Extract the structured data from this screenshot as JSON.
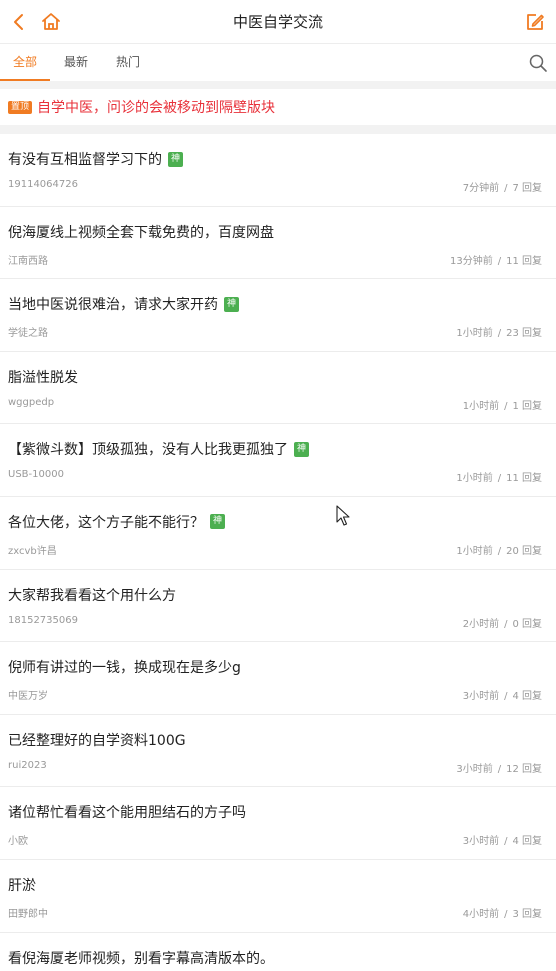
{
  "header": {
    "title": "中医自学交流",
    "back_icon": "chevron-left-icon",
    "home_icon": "home-icon",
    "edit_icon": "edit-icon",
    "accent_color": "#f07b22"
  },
  "tabs": [
    {
      "label": "全部",
      "active": true
    },
    {
      "label": "最新",
      "active": false
    },
    {
      "label": "热门",
      "active": false
    }
  ],
  "pinned": {
    "badge": "置顶",
    "title": "自学中医，问诊的会被移动到隔壁版块",
    "color": "#e8313a"
  },
  "posts": [
    {
      "title": "有没有互相监督学习下的",
      "badge": "神",
      "author": "19114064726",
      "time": "7分钟前",
      "replies": "7 回复"
    },
    {
      "title": "倪海厦线上视频全套下载免费的，百度网盘",
      "badge": "",
      "author": "江南西路",
      "time": "13分钟前",
      "replies": "11 回复"
    },
    {
      "title": "当地中医说很难治，请求大家开药",
      "badge": "神",
      "author": "学徒之路",
      "time": "1小时前",
      "replies": "23 回复"
    },
    {
      "title": "脂溢性脱发",
      "badge": "",
      "author": "wggpedp",
      "time": "1小时前",
      "replies": "1 回复"
    },
    {
      "title": "【紫微斗数】顶级孤独，没有人比我更孤独了",
      "badge": "神",
      "author": "USB-10000",
      "time": "1小时前",
      "replies": "11 回复"
    },
    {
      "title": "各位大佬，这个方子能不能行？",
      "badge": "神",
      "author": "zxcvb许昌",
      "time": "1小时前",
      "replies": "20 回复"
    },
    {
      "title": "大家帮我看看这个用什么方",
      "badge": "",
      "author": "18152735069",
      "time": "2小时前",
      "replies": "0 回复"
    },
    {
      "title": "倪师有讲过的一钱，换成现在是多少g",
      "badge": "",
      "author": "中医万岁",
      "time": "3小时前",
      "replies": "4 回复"
    },
    {
      "title": "已经整理好的自学资料100G",
      "badge": "",
      "author": "rui2023",
      "time": "3小时前",
      "replies": "12 回复"
    },
    {
      "title": "诸位帮忙看看这个能用胆结石的方子吗",
      "badge": "",
      "author": "小欧",
      "time": "3小时前",
      "replies": "4 回复"
    },
    {
      "title": "肝淤",
      "badge": "",
      "author": "田野郎中",
      "time": "4小时前",
      "replies": "3 回复"
    },
    {
      "title": "看倪海厦老师视频，别看字幕高清版本的。",
      "badge": "",
      "author": "",
      "time": "",
      "replies": ""
    }
  ],
  "meta_separator": "/",
  "badge_color": "#4caf50"
}
